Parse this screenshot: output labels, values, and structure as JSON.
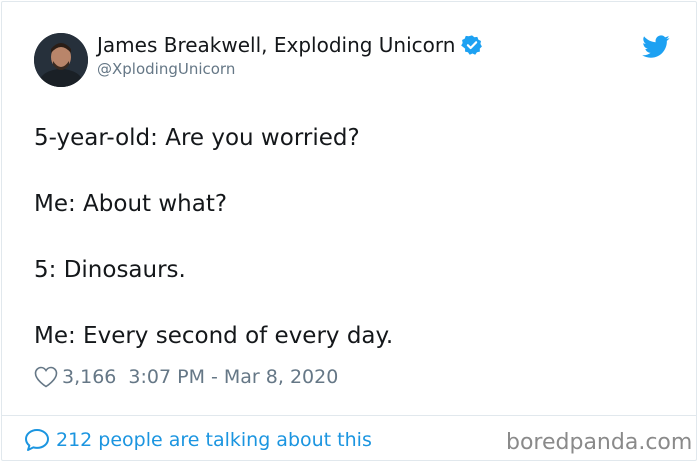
{
  "tweet": {
    "display_name": "James Breakwell, Exploding Unicorn",
    "handle": "@XplodingUnicorn",
    "lines": [
      "5-year-old: Are you worried?",
      "Me: About what?",
      "5: Dinosaurs.",
      "Me: Every second of every day."
    ],
    "likes": "3,166",
    "timestamp": "3:07 PM - Mar 8, 2020",
    "talking": "212 people are talking about this"
  },
  "watermark": "boredpanda.com",
  "colors": {
    "accent": "#1da1f2",
    "link": "#1b95e0",
    "muted": "#657786"
  },
  "icons": [
    "verified-badge-icon",
    "twitter-bird-icon",
    "heart-icon",
    "comment-bubble-icon"
  ]
}
